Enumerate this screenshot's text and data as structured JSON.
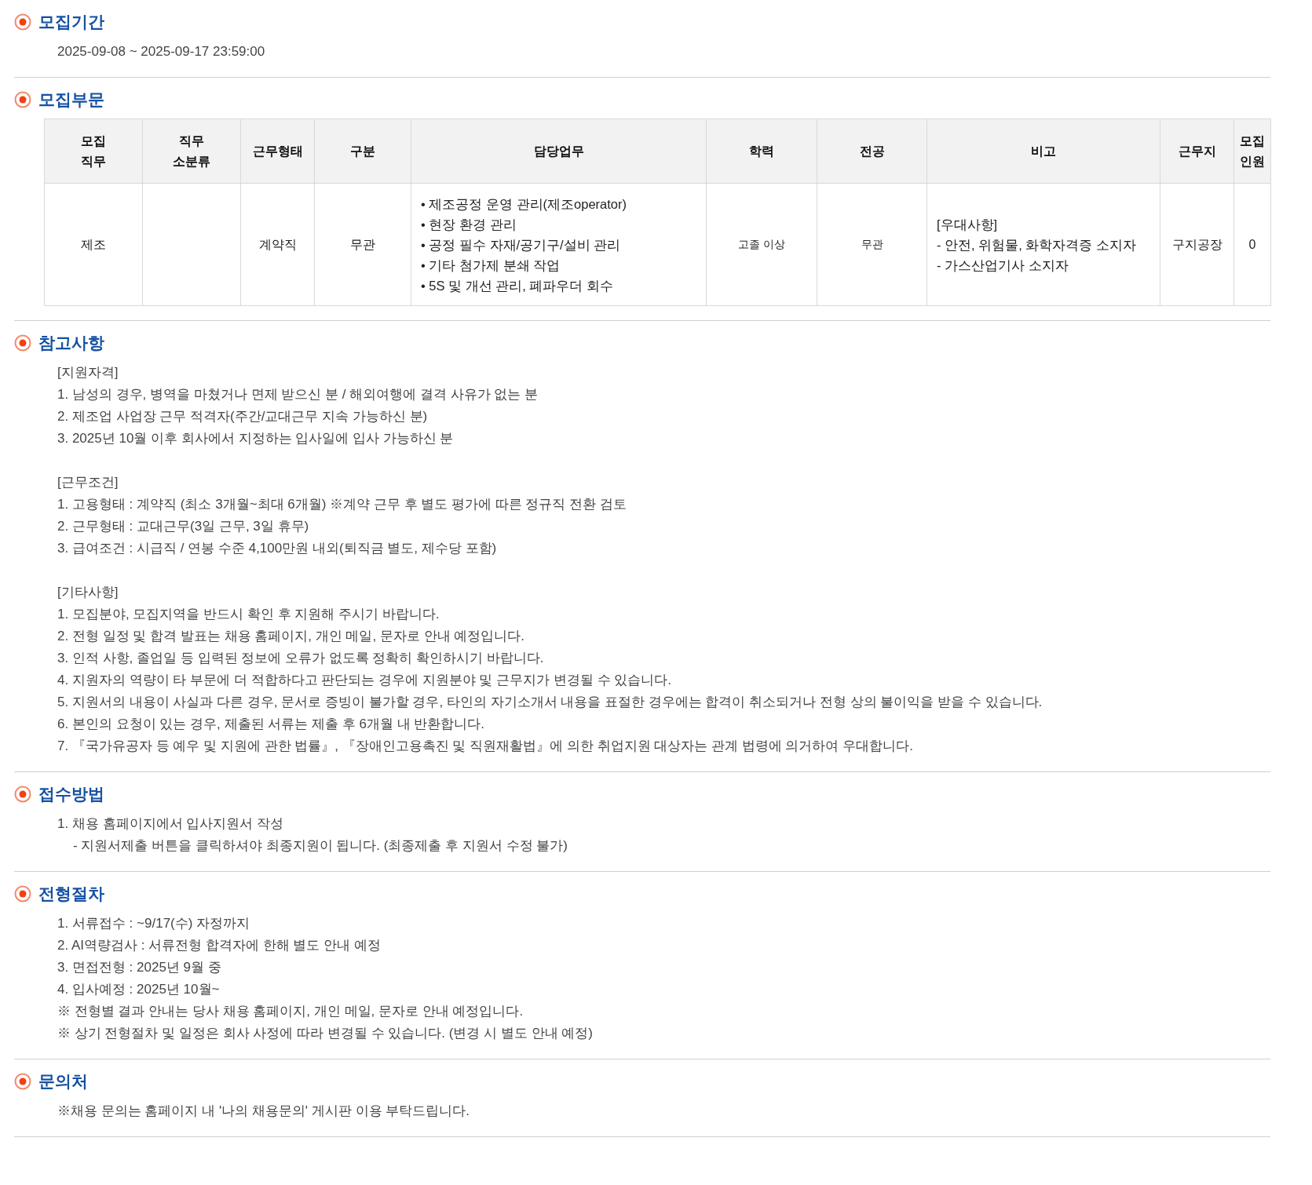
{
  "sections": [
    {
      "title": "모집기간",
      "kind": "lines",
      "groups": [
        [
          {
            "text": "2025-09-08 ~ 2025-09-17 23:59:00"
          }
        ]
      ]
    },
    {
      "title": "모집부문",
      "kind": "table",
      "table": {
        "columns": [
          "모집\n직무",
          "직무\n소분류",
          "근무형태",
          "구분",
          "담당업무",
          "학력",
          "전공",
          "비고",
          "근무지",
          "모집\n인원"
        ],
        "rows": [
          [
            {
              "kind": "text",
              "text": "제조"
            },
            {
              "kind": "empty"
            },
            {
              "kind": "text",
              "text": "계약직"
            },
            {
              "kind": "text",
              "text": "무관"
            },
            {
              "kind": "list",
              "lines": [
                "• 제조공정 운영 관리(제조operator)",
                "• 현장 환경 관리",
                "• 공정 필수 자재/공기구/설비 관리",
                "• 기타 첨가제 분쇄 작업",
                "• 5S 및 개선 관리, 폐파우더 회수"
              ]
            },
            {
              "kind": "small",
              "text": "고졸 이상"
            },
            {
              "kind": "small",
              "text": "무관"
            },
            {
              "kind": "list",
              "lines": [
                "[우대사항]",
                "- 안전, 위험물, 화학자격증 소지자",
                "- 가스산업기사 소지자"
              ]
            },
            {
              "kind": "text",
              "text": "구지공장"
            },
            {
              "kind": "text",
              "text": "0"
            }
          ]
        ]
      }
    },
    {
      "title": "참고사항",
      "kind": "lines",
      "groups": [
        [
          {
            "text": "[지원자격]"
          },
          {
            "text": "1. 남성의 경우, 병역을 마쳤거나 면제 받으신 분 / 해외여행에 결격 사유가 없는 분"
          },
          {
            "text": "2. 제조업 사업장 근무 적격자(주간/교대근무 지속 가능하신 분)"
          },
          {
            "text": "3. 2025년 10월 이후 회사에서 지정하는 입사일에 입사 가능하신 분"
          }
        ],
        [
          {
            "text": "[근무조건]"
          },
          {
            "text": "1. 고용형태 : 계약직 (최소 3개월~최대 6개월) ※계약 근무 후 별도 평가에 따른 정규직 전환 검토"
          },
          {
            "text": "2. 근무형태 : 교대근무(3일 근무, 3일 휴무)"
          },
          {
            "text": "3. 급여조건 : 시급직 / 연봉 수준 4,100만원 내외(퇴직금 별도, 제수당 포함)"
          }
        ],
        [
          {
            "text": "[기타사항]"
          },
          {
            "text": "1. 모집분야, 모집지역을 반드시 확인 후 지원해 주시기 바랍니다."
          },
          {
            "text": "2. 전형 일정 및 합격 발표는 채용 홈페이지, 개인 메일, 문자로 안내 예정입니다."
          },
          {
            "text": "3. 인적 사항, 졸업일 등 입력된 정보에 오류가 없도록 정확히 확인하시기 바랍니다."
          },
          {
            "text": "4. 지원자의 역량이 타 부문에 더 적합하다고 판단되는 경우에 지원분야 및 근무지가 변경될 수 있습니다."
          },
          {
            "text": "5. 지원서의 내용이 사실과 다른 경우, 문서로 증빙이 불가할 경우, 타인의 자기소개서 내용을 표절한 경우에는 합격이 취소되거나 전형 상의 불이익을 받을 수 있습니다."
          },
          {
            "text": "6. 본인의 요청이 있는 경우, 제출된 서류는 제출 후 6개월 내 반환합니다."
          },
          {
            "text": "7. 『국가유공자 등 예우 및 지원에 관한 법률』, 『장애인고용촉진 및 직원재활법』에 의한 취업지원 대상자는 관계 법령에 의거하여 우대합니다."
          }
        ]
      ]
    },
    {
      "title": "접수방법",
      "kind": "lines",
      "groups": [
        [
          {
            "text": "1. 채용 홈페이지에서 입사지원서 작성",
            "children": [
              {
                "text": "- 지원서제출 버튼을 클릭하셔야 최종지원이 됩니다. (최종제출 후 지원서 수정 불가)"
              }
            ]
          }
        ]
      ]
    },
    {
      "title": "전형절차",
      "kind": "lines",
      "groups": [
        [
          {
            "text": "1. 서류접수 : ~9/17(수) 자정까지"
          },
          {
            "text": "2. AI역량검사 : 서류전형 합격자에 한해 별도 안내 예정"
          },
          {
            "text": "3. 면접전형 : 2025년 9월 중"
          },
          {
            "text": "4. 입사예정 : 2025년 10월~"
          },
          {
            "text": "※ 전형별 결과 안내는 당사 채용 홈페이지, 개인 메일, 문자로 안내 예정입니다."
          },
          {
            "text": "※ 상기 전형절차 및 일정은 회사 사정에 따라 변경될 수 있습니다. (변경 시 별도 안내 예정)"
          }
        ]
      ]
    },
    {
      "title": "문의처",
      "kind": "lines",
      "groups": [
        [
          {
            "text": "※채용 문의는 홈페이지 내 '나의 채용문의' 게시판 이용 부탁드립니다."
          }
        ]
      ]
    }
  ]
}
